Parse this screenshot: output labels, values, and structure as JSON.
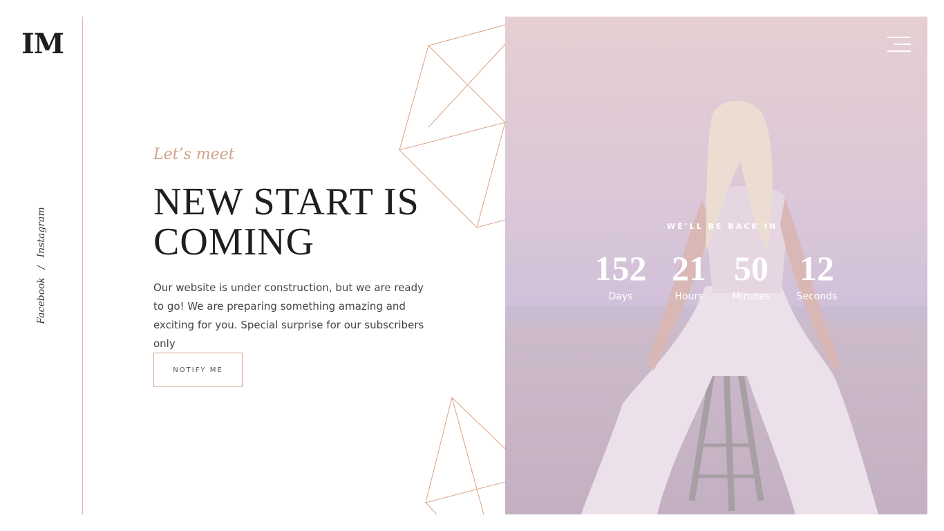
{
  "brand": {
    "logo": "IM"
  },
  "social": {
    "facebook": "Facebook",
    "separator": "/",
    "instagram": "Instagram"
  },
  "hero": {
    "eyebrow": "Let’s meet",
    "headline_line1": "NEW START IS",
    "headline_line2": "COMING",
    "description": "Our website is under construction, but we are ready to go! We are preparing something amazing and exciting for you. Special surprise for our subscribers only",
    "cta_label": "NOTIFY ME"
  },
  "countdown": {
    "label": "WE’LL BE BACK IN",
    "days": {
      "value": "152",
      "label": "Days"
    },
    "hours": {
      "value": "21",
      "label": "Hours"
    },
    "minutes": {
      "value": "50",
      "label": "Minutes"
    },
    "seconds": {
      "value": "12",
      "label": "Seconds"
    }
  },
  "colors": {
    "accent": "#d1a38a",
    "text": "#1e1e1e",
    "overlay": "#d9c6d8"
  },
  "icons": {
    "menu": "hamburger-menu-icon"
  }
}
